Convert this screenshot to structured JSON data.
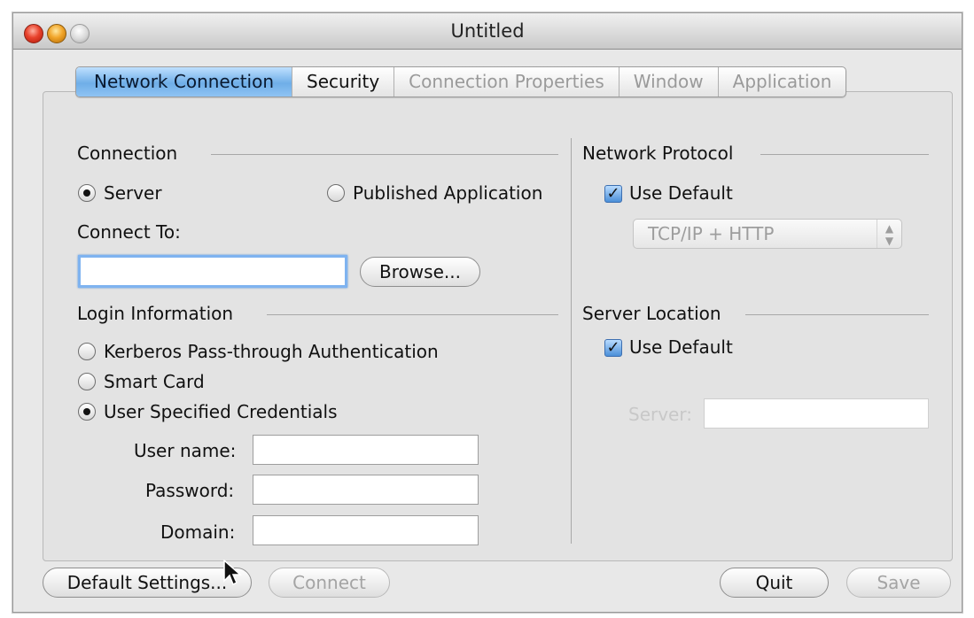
{
  "window": {
    "title": "Untitled"
  },
  "tabs": [
    {
      "label": "Network Connection",
      "state": "active"
    },
    {
      "label": "Security",
      "state": "normal"
    },
    {
      "label": "Connection Properties",
      "state": "disabled"
    },
    {
      "label": "Window",
      "state": "disabled"
    },
    {
      "label": "Application",
      "state": "disabled"
    }
  ],
  "connection": {
    "heading": "Connection",
    "server_label": "Server",
    "server_selected": true,
    "published_label": "Published Application",
    "published_selected": false,
    "connect_to_label": "Connect To:",
    "connect_to_value": "",
    "browse_label": "Browse..."
  },
  "login": {
    "heading": "Login Information",
    "kerberos_label": "Kerberos Pass-through Authentication",
    "smartcard_label": "Smart Card",
    "user_specified_label": "User Specified Credentials",
    "selected": "User Specified Credentials",
    "username_label": "User name:",
    "username_value": "",
    "password_label": "Password:",
    "password_value": "",
    "domain_label": "Domain:",
    "domain_value": ""
  },
  "network_protocol": {
    "heading": "Network Protocol",
    "use_default_label": "Use Default",
    "use_default_checked": true,
    "protocol_value": "TCP/IP + HTTP"
  },
  "server_location": {
    "heading": "Server Location",
    "use_default_label": "Use Default",
    "use_default_checked": true,
    "server_label": "Server:",
    "server_value": ""
  },
  "buttons": {
    "default_settings": "Default Settings...",
    "connect": "Connect",
    "quit": "Quit",
    "save": "Save"
  },
  "icons": {
    "close": "close-icon",
    "minimize": "minimize-icon",
    "zoom": "zoom-icon",
    "check": "checkmark-icon",
    "cursor": "mouse-pointer-icon"
  },
  "colors": {
    "active_tab": "#6faee8",
    "checkbox": "#4b8fd8",
    "focus_ring": "#7fb3f0"
  }
}
